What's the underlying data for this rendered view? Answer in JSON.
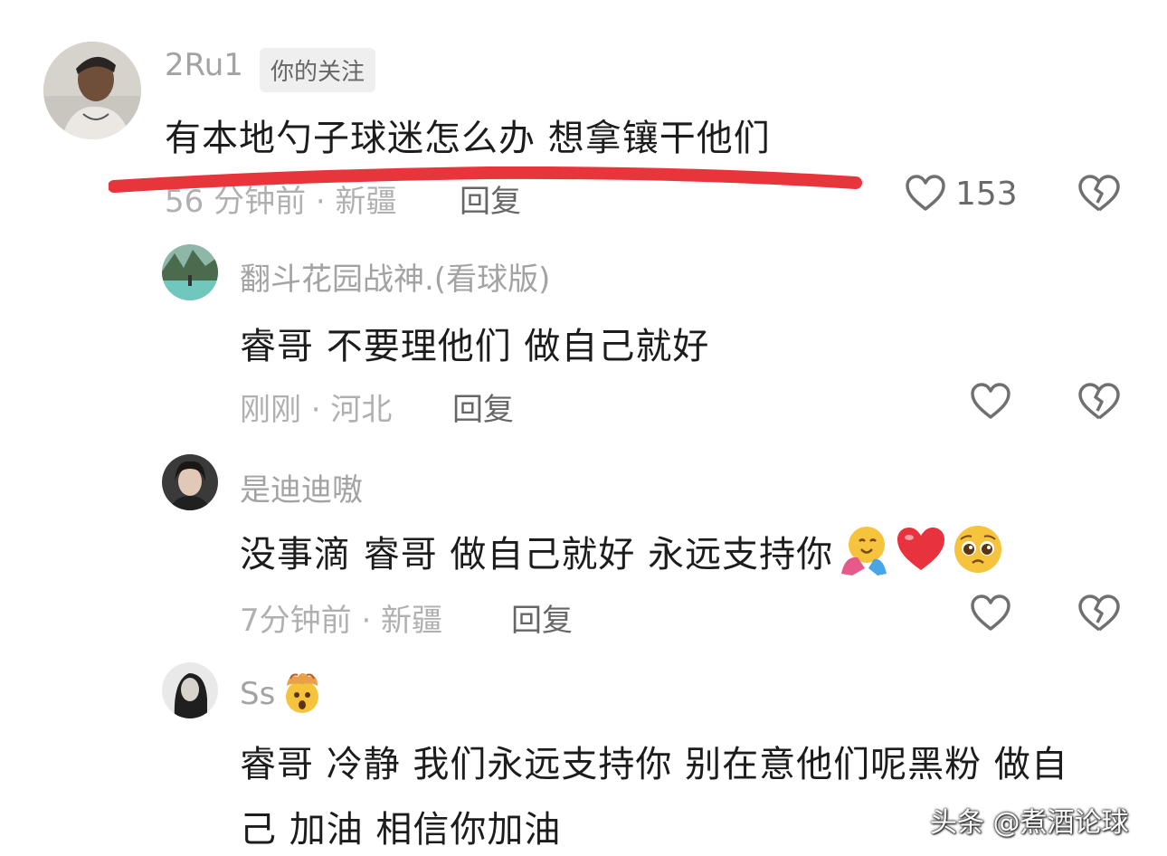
{
  "comments": [
    {
      "username": "2Ru1",
      "tag": "你的关注",
      "text": "有本地勺子球迷怎么办 想拿镶干他们",
      "meta": "56 分钟前 · 新疆",
      "reply": "回复",
      "likes": "153"
    },
    {
      "username": "翻斗花园战神.(看球版)",
      "text": "睿哥 不要理他们 做自己就好",
      "meta": "刚刚 · 河北",
      "reply": "回复"
    },
    {
      "username": "是迪迪嗷",
      "text": "没事滴 睿哥 做自己就好 永远支持你",
      "meta": "7分钟前 · 新疆",
      "reply": "回复",
      "emojis": [
        "hugging-face",
        "red-heart",
        "pleading-face"
      ]
    },
    {
      "username": "Ss",
      "username_emoji": "exploding-head",
      "text_line1": "睿哥 冷静 我们永远支持你 别在意他们呢黑粉 做自",
      "text_line2": "己 加油 相信你加油"
    }
  ],
  "watermark": "头条 @煮酒论球",
  "colors": {
    "underline": "#e8353c",
    "heart": "#e8333e"
  }
}
